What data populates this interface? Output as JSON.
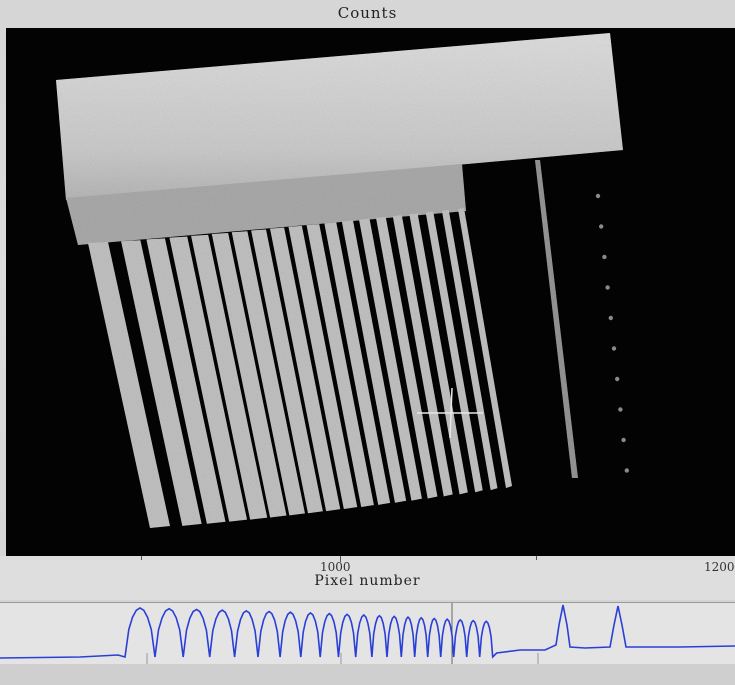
{
  "window": {
    "title": "Counts"
  },
  "x_axis": {
    "title": "Pixel number",
    "ticks": [
      "1000",
      "1200"
    ]
  },
  "cursor": {
    "type": "crosshair"
  },
  "colors": {
    "profile_line": "#2a3fd8",
    "image_background": "#030303",
    "sample_fill": "#cfcfcf"
  },
  "profile": {
    "peak_count": 20,
    "single_peaks": 2
  }
}
